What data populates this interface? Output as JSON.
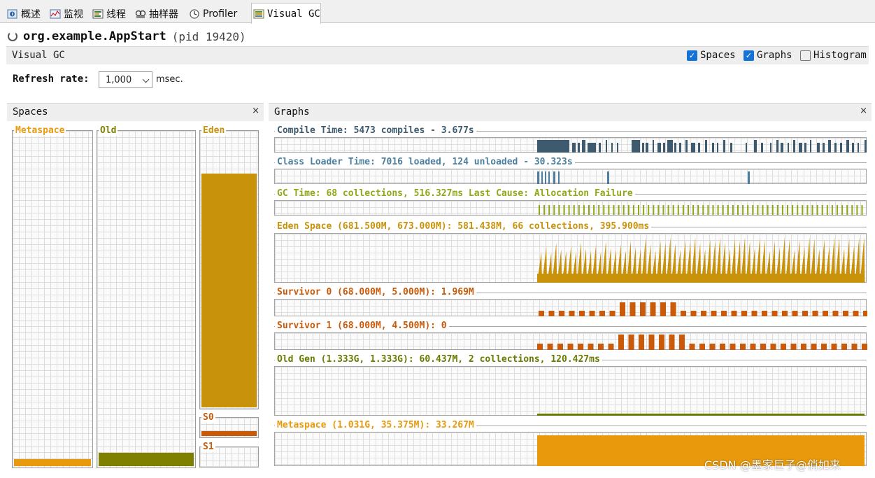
{
  "tabs": [
    {
      "label": "概述",
      "icon": "info-icon"
    },
    {
      "label": "监视",
      "icon": "monitor-icon"
    },
    {
      "label": "线程",
      "icon": "threads-icon"
    },
    {
      "label": "抽样器",
      "icon": "sampler-icon"
    },
    {
      "label": "Profiler",
      "icon": "clock-icon"
    },
    {
      "label": "Visual GC",
      "icon": "visual-gc-icon",
      "active": true
    }
  ],
  "app": {
    "name": "org.example.AppStart",
    "pid": "(pid 19420)"
  },
  "vgc": {
    "label": "Visual GC",
    "options": [
      {
        "label": "Spaces",
        "checked": true
      },
      {
        "label": "Graphs",
        "checked": true
      },
      {
        "label": "Histogram",
        "checked": false
      }
    ]
  },
  "refresh": {
    "label": "Refresh rate:",
    "value": "1,000",
    "unit": "msec."
  },
  "spaces_panel": {
    "title": "Spaces",
    "close": "×",
    "items": [
      {
        "label": "Metaspace",
        "color": "#e89a0c",
        "fill": 0.02
      },
      {
        "label": "Old",
        "color": "#808000",
        "fill": 0.04
      },
      {
        "label": "Eden",
        "color": "#c8920a",
        "fill": 0.85
      },
      {
        "label": "S0",
        "color": "#c85a0a",
        "fill": 0.3
      },
      {
        "label": "S1",
        "color": "#c85a0a",
        "fill": 0.0
      }
    ]
  },
  "graphs_panel": {
    "title": "Graphs",
    "close": "×",
    "items": [
      {
        "title": "Compile Time: 5473 compiles - 3.677s",
        "color": "#3d5a6e"
      },
      {
        "title": "Class Loader Time: 7016 loaded, 124 unloaded - 30.323s",
        "color": "#4d7e9e"
      },
      {
        "title": "GC Time: 68 collections, 516.327ms Last Cause: Allocation Failure",
        "color": "#8fa818"
      },
      {
        "title": "Eden Space (681.500M, 673.000M): 581.438M, 66 collections, 395.900ms",
        "color": "#c8920a"
      },
      {
        "title": "Survivor 0 (68.000M, 5.000M): 1.969M",
        "color": "#c85a0a"
      },
      {
        "title": "Survivor 1 (68.000M, 4.500M): 0",
        "color": "#c85a0a"
      },
      {
        "title": "Old Gen (1.333G, 1.333G): 60.437M, 2 collections, 120.427ms",
        "color": "#6b7a00"
      },
      {
        "title": "Metaspace (1.031G, 35.375M): 33.267M",
        "color": "#e89a0c"
      }
    ]
  },
  "watermark": "CSDN @墨家巨子@俏如来"
}
